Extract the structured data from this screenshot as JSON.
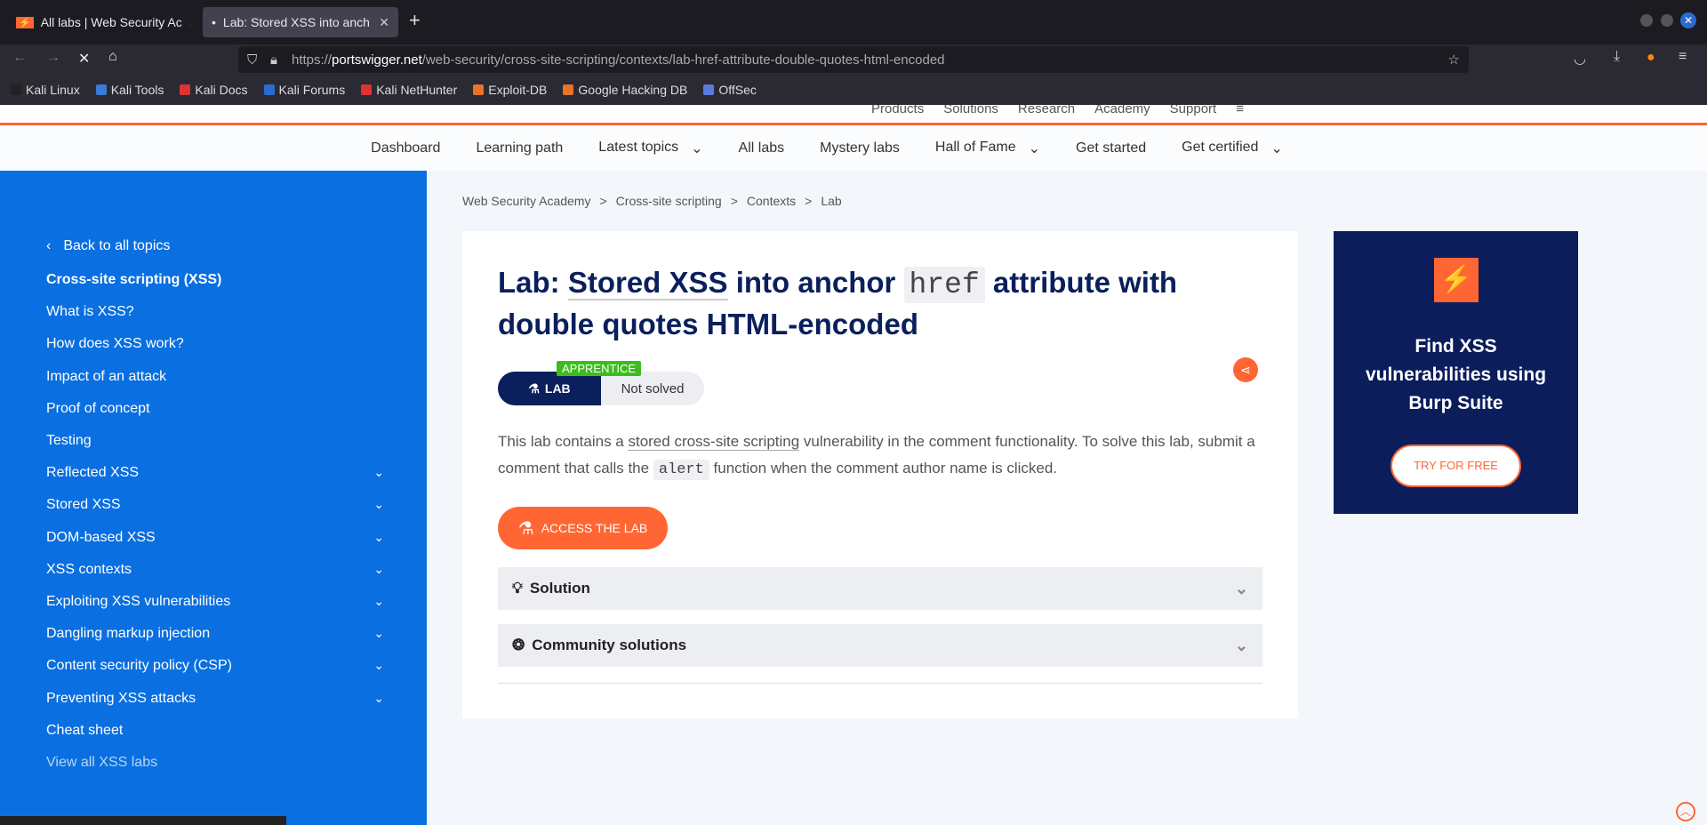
{
  "browser": {
    "tabs": [
      {
        "label": "All labs | Web Security Ac",
        "active": false
      },
      {
        "label": "Lab: Stored XSS into anch",
        "active": true
      }
    ],
    "url_domain": "portswigger.net",
    "url_prefix": "https://",
    "url_path": "/web-security/cross-site-scripting/contexts/lab-href-attribute-double-quotes-html-encoded",
    "bookmarks": [
      {
        "label": "Kali Linux",
        "color": "#222"
      },
      {
        "label": "Kali Tools",
        "color": "#3a7bd5"
      },
      {
        "label": "Kali Docs",
        "color": "#d33"
      },
      {
        "label": "Kali Forums",
        "color": "#2a6bd0"
      },
      {
        "label": "Kali NetHunter",
        "color": "#d33"
      },
      {
        "label": "Exploit-DB",
        "color": "#e8742a"
      },
      {
        "label": "Google Hacking DB",
        "color": "#e8742a"
      },
      {
        "label": "OffSec",
        "color": "#5b7be0"
      }
    ]
  },
  "topnav": [
    "Products",
    "Solutions",
    "Research",
    "Academy",
    "Support"
  ],
  "subnav": [
    "Dashboard",
    "Learning path",
    "Latest topics",
    "All labs",
    "Mystery labs",
    "Hall of Fame",
    "Get started",
    "Get certified"
  ],
  "sidebar": {
    "back": "Back to all topics",
    "items": [
      {
        "label": "Cross-site scripting (XSS)",
        "bold": true,
        "chev": false
      },
      {
        "label": "What is XSS?",
        "chev": false
      },
      {
        "label": "How does XSS work?",
        "chev": false
      },
      {
        "label": "Impact of an attack",
        "chev": false
      },
      {
        "label": "Proof of concept",
        "chev": false
      },
      {
        "label": "Testing",
        "chev": false
      },
      {
        "label": "Reflected XSS",
        "chev": true
      },
      {
        "label": "Stored XSS",
        "chev": true
      },
      {
        "label": "DOM-based XSS",
        "chev": true
      },
      {
        "label": "XSS contexts",
        "chev": true
      },
      {
        "label": "Exploiting XSS vulnerabilities",
        "chev": true
      },
      {
        "label": "Dangling markup injection",
        "chev": true
      },
      {
        "label": "Content security policy (CSP)",
        "chev": true
      },
      {
        "label": "Preventing XSS attacks",
        "chev": true
      },
      {
        "label": "Cheat sheet",
        "chev": false
      },
      {
        "label": "View all XSS labs",
        "chev": false,
        "muted": true
      }
    ]
  },
  "breadcrumb": [
    "Web Security Academy",
    "Cross-site scripting",
    "Contexts",
    "Lab"
  ],
  "lab": {
    "title_prefix": "Lab: ",
    "title_link": "Stored XSS",
    "title_mid": " into anchor ",
    "title_code": "href",
    "title_suffix": " attribute with double quotes HTML-encoded",
    "level": "APPRENTICE",
    "badge": "LAB",
    "status": "Not solved",
    "desc_1": "This lab contains a ",
    "desc_link": "stored cross-site scripting",
    "desc_2": " vulnerability in the comment functionality. To solve this lab, submit a comment that calls the ",
    "desc_code": "alert",
    "desc_3": " function when the comment author name is clicked.",
    "access": "ACCESS THE LAB",
    "panels": [
      "Solution",
      "Community solutions"
    ]
  },
  "ad": {
    "title": "Find XSS vulnerabilities using Burp Suite",
    "button": "TRY FOR FREE"
  },
  "colors": {
    "sidebar": "#0a6fe0",
    "accent": "#ff6633",
    "navy": "#0a1f5c"
  }
}
